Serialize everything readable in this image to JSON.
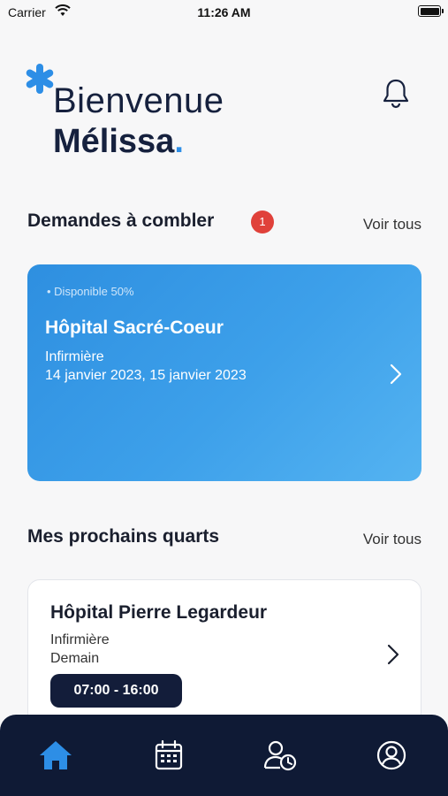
{
  "status_bar": {
    "carrier": "Carrier",
    "time": "11:26 AM"
  },
  "header": {
    "greeting": "Bienvenue",
    "user_name": "Mélissa",
    "user_name_dot": ".",
    "accent_color": "#2d8ee6"
  },
  "requests": {
    "title": "Demandes à combler",
    "badge_count": "1",
    "see_all": "Voir tous",
    "card": {
      "availability": "• Disponible 50%",
      "hospital": "Hôpital Sacré-Coeur",
      "role": "Infirmière",
      "dates": "14 janvier 2023, 15 janvier 2023"
    }
  },
  "shifts": {
    "title": "Mes prochains quarts",
    "see_all": "Voir tous",
    "card": {
      "hospital": "Hôpital Pierre Legardeur",
      "role": "Infirmière",
      "day": "Demain",
      "time": "07:00 - 16:00"
    }
  },
  "tab_bar": {
    "tabs": [
      {
        "icon": "home-icon",
        "active": true
      },
      {
        "icon": "calendar-icon",
        "active": false
      },
      {
        "icon": "user-clock-icon",
        "active": false
      },
      {
        "icon": "profile-icon",
        "active": false
      }
    ],
    "active_color": "#2d8ee6",
    "background": "#0f1a35"
  }
}
